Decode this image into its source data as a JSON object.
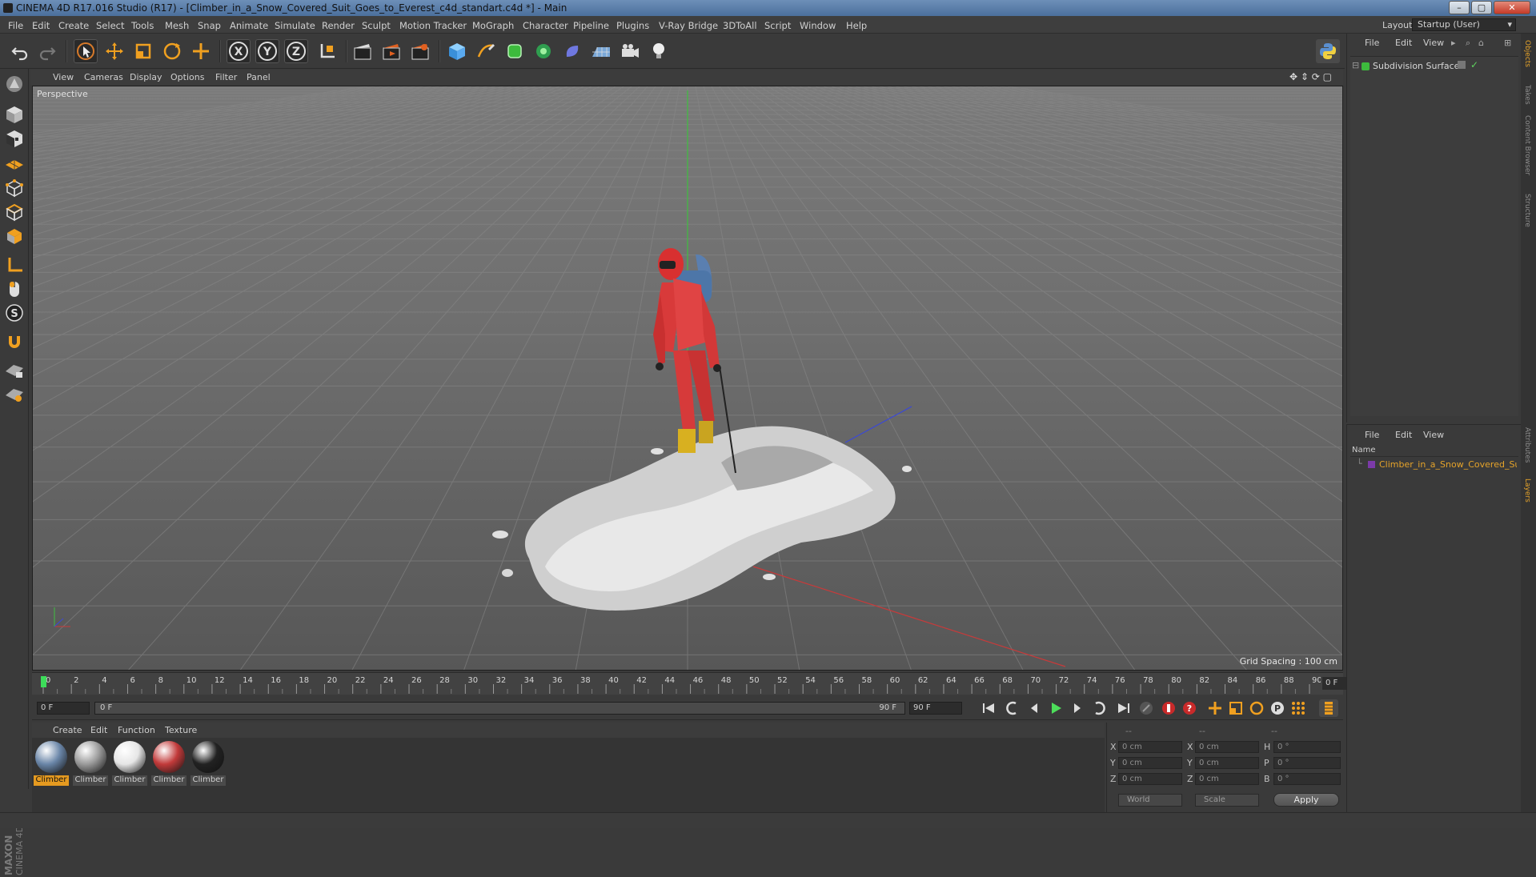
{
  "window": {
    "title": "CINEMA 4D R17.016 Studio (R17) - [Climber_in_a_Snow_Covered_Suit_Goes_to_Everest_c4d_standart.c4d *] - Main",
    "minimize": "–",
    "maximize": "▢",
    "close": "✕"
  },
  "menu": [
    "File",
    "Edit",
    "Create",
    "Select",
    "Tools",
    "Mesh",
    "Snap",
    "Animate",
    "Simulate",
    "Render",
    "Sculpt",
    "Motion Tracker",
    "MoGraph",
    "Character",
    "Pipeline",
    "Plugins",
    "V-Ray Bridge",
    "3DToAll",
    "Script",
    "Window",
    "Help"
  ],
  "layout": {
    "label": "Layout:",
    "value": "Startup (User)"
  },
  "toolbar": {
    "axis_x": "X",
    "axis_y": "Y",
    "axis_z": "Z"
  },
  "viewport": {
    "menu": [
      "View",
      "Cameras",
      "Display",
      "Options",
      "Filter",
      "Panel"
    ],
    "label": "Perspective",
    "grid_spacing": "Grid Spacing : 100 cm"
  },
  "timeline": {
    "ticks": [
      "0",
      "2",
      "4",
      "6",
      "8",
      "10",
      "12",
      "14",
      "16",
      "18",
      "20",
      "22",
      "24",
      "26",
      "28",
      "30",
      "32",
      "34",
      "36",
      "38",
      "40",
      "42",
      "44",
      "46",
      "48",
      "50",
      "52",
      "54",
      "56",
      "58",
      "60",
      "62",
      "64",
      "66",
      "68",
      "70",
      "72",
      "74",
      "76",
      "78",
      "80",
      "82",
      "84",
      "86",
      "88",
      "90"
    ],
    "current_frame": "0 F",
    "start_field": "0 F",
    "range_start": "0 F",
    "range_end": "90 F",
    "end_field": "90 F"
  },
  "materials": {
    "menu": [
      "Create",
      "Edit",
      "Function",
      "Texture"
    ],
    "items": [
      {
        "label": "Climber",
        "selected": true,
        "color": "#6a86a8"
      },
      {
        "label": "Climber",
        "selected": false,
        "color": "#9a9a9a"
      },
      {
        "label": "Climber",
        "selected": false,
        "color": "#e6e6e6"
      },
      {
        "label": "Climber",
        "selected": false,
        "color": "#c23a3a"
      },
      {
        "label": "Climber",
        "selected": false,
        "color": "#222222"
      }
    ]
  },
  "coordinates": {
    "header": [
      "--",
      "--",
      "--"
    ],
    "rows": [
      {
        "l1": "X",
        "v1": "0 cm",
        "l2": "X",
        "v2": "0 cm",
        "l3": "H",
        "v3": "0 °"
      },
      {
        "l1": "Y",
        "v1": "0 cm",
        "l2": "Y",
        "v2": "0 cm",
        "l3": "P",
        "v3": "0 °"
      },
      {
        "l1": "Z",
        "v1": "0 cm",
        "l2": "Z",
        "v2": "0 cm",
        "l3": "B",
        "v3": "0 °"
      }
    ],
    "mode1": "World",
    "mode2": "Scale",
    "apply": "Apply"
  },
  "objects": {
    "menu": [
      "File",
      "Edit",
      "View"
    ],
    "items": [
      {
        "name": "Subdivision Surface"
      }
    ]
  },
  "layers": {
    "menu": [
      "File",
      "Edit",
      "View"
    ],
    "column": "Name",
    "items": [
      {
        "name": "Climber_in_a_Snow_Covered_Suit"
      }
    ]
  },
  "side_tabs": [
    "Objects",
    "Takes",
    "Content Browser",
    "Structure",
    "Attributes",
    "Layers"
  ],
  "brand": "MAXON CINEMA 4D",
  "colors": {
    "accent": "#e59a20",
    "layer_text": "#e5a32a",
    "green": "#5fd35f"
  }
}
